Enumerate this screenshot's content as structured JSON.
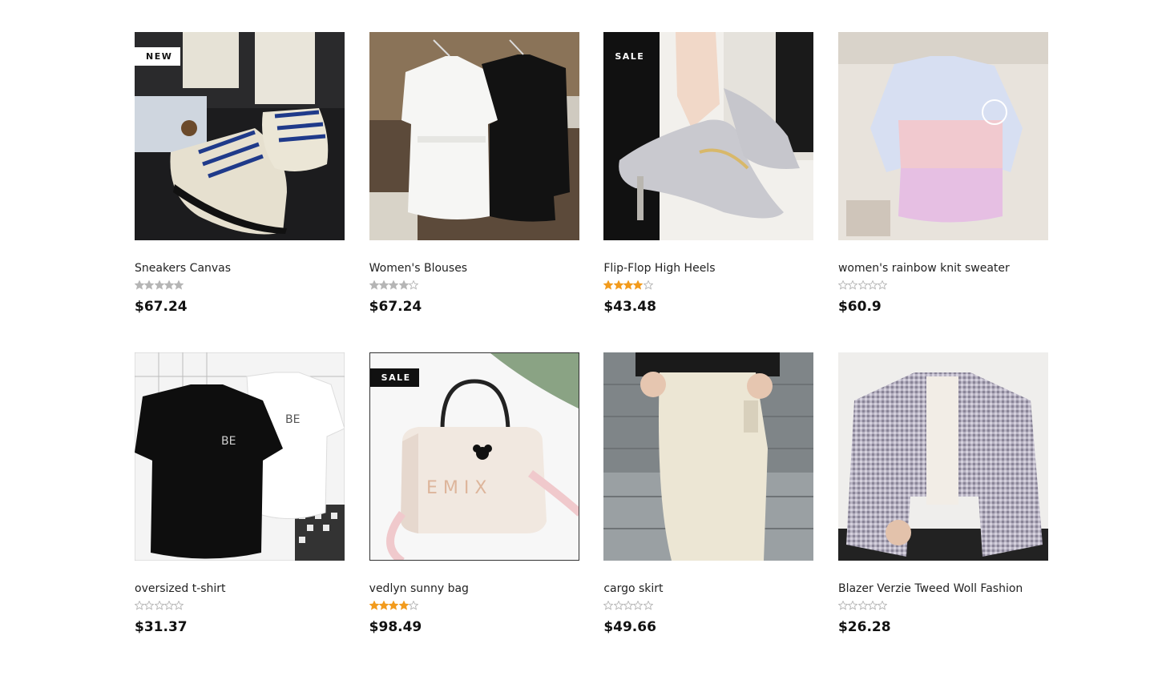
{
  "products": [
    {
      "title": "Sneakers Canvas",
      "price": "$67.24",
      "badge": "NEW",
      "rating": 5,
      "star_color": "#b5b5b5",
      "image": "sneakers"
    },
    {
      "title": "Women's Blouses",
      "price": "$67.24",
      "badge": "",
      "rating": 4,
      "star_color": "#b5b5b5",
      "image": "blouses"
    },
    {
      "title": "Flip-Flop High Heels",
      "price": "$43.48",
      "badge": "SALE",
      "rating": 4,
      "star_color": "#f29b1d",
      "image": "heels"
    },
    {
      "title": "women's rainbow knit sweater",
      "price": "$60.9",
      "badge": "",
      "rating": 0,
      "star_color": "#b5b5b5",
      "image": "sweater"
    },
    {
      "title": "oversized t-shirt",
      "price": "$31.37",
      "badge": "",
      "rating": 0,
      "star_color": "#b5b5b5",
      "image": "tshirt"
    },
    {
      "title": "vedlyn sunny bag",
      "price": "$98.49",
      "badge": "SALE",
      "rating": 4,
      "star_color": "#f29b1d",
      "image": "bag"
    },
    {
      "title": "cargo skirt",
      "price": "$49.66",
      "badge": "",
      "rating": 0,
      "star_color": "#b5b5b5",
      "image": "skirt"
    },
    {
      "title": "Blazer Verzie Tweed Woll Fashion",
      "price": "$26.28",
      "badge": "",
      "rating": 0,
      "star_color": "#b5b5b5",
      "image": "blazer"
    }
  ]
}
